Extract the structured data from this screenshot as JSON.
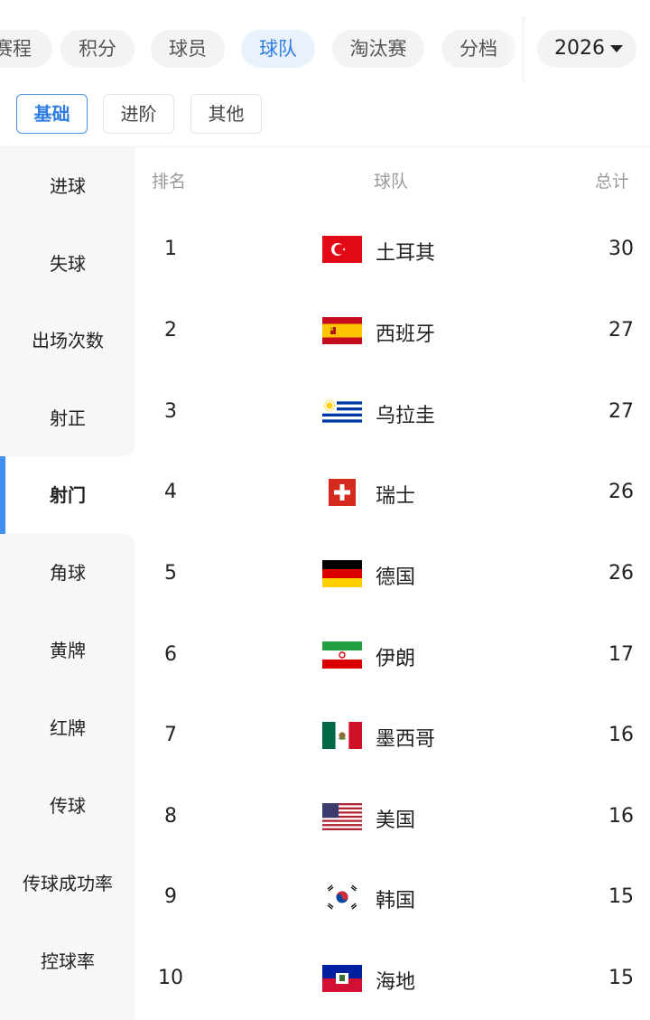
{
  "top_tabs": [
    {
      "label": "赛程"
    },
    {
      "label": "积分"
    },
    {
      "label": "球员"
    },
    {
      "label": "球队"
    },
    {
      "label": "淘汰赛"
    },
    {
      "label": "分档"
    }
  ],
  "active_top_tab": "球队",
  "year_selector": {
    "value": "2026",
    "icon": "caret-down-icon"
  },
  "sub_tabs": [
    {
      "label": "基础"
    },
    {
      "label": "进阶"
    },
    {
      "label": "其他"
    }
  ],
  "active_sub_tab": "基础",
  "sidebar": {
    "items": [
      {
        "label": "进球"
      },
      {
        "label": "失球"
      },
      {
        "label": "出场次数"
      },
      {
        "label": "射正"
      },
      {
        "label": "射门"
      },
      {
        "label": "角球"
      },
      {
        "label": "黄牌"
      },
      {
        "label": "红牌"
      },
      {
        "label": "传球"
      },
      {
        "label": "传球成功率"
      },
      {
        "label": "控球率"
      }
    ],
    "active": "射门"
  },
  "table": {
    "headers": {
      "rank": "排名",
      "team": "球队",
      "total": "总计"
    },
    "rows": [
      {
        "rank": "1",
        "team": "土耳其",
        "total": "30",
        "flag": "turkey-flag-icon"
      },
      {
        "rank": "2",
        "team": "西班牙",
        "total": "27",
        "flag": "spain-flag-icon"
      },
      {
        "rank": "3",
        "team": "乌拉圭",
        "total": "27",
        "flag": "uruguay-flag-icon"
      },
      {
        "rank": "4",
        "team": "瑞士",
        "total": "26",
        "flag": "switzerland-flag-icon"
      },
      {
        "rank": "5",
        "team": "德国",
        "total": "26",
        "flag": "germany-flag-icon"
      },
      {
        "rank": "6",
        "team": "伊朗",
        "total": "17",
        "flag": "iran-flag-icon"
      },
      {
        "rank": "7",
        "team": "墨西哥",
        "total": "16",
        "flag": "mexico-flag-icon"
      },
      {
        "rank": "8",
        "team": "美国",
        "total": "16",
        "flag": "usa-flag-icon"
      },
      {
        "rank": "9",
        "team": "韩国",
        "total": "15",
        "flag": "south-korea-flag-icon"
      },
      {
        "rank": "10",
        "team": "海地",
        "total": "15",
        "flag": "haiti-flag-icon"
      }
    ]
  },
  "colors": {
    "accent": "#2f7de1",
    "sidebar_bg": "#f6f7f9",
    "pill_bg": "#f2f3f5"
  }
}
